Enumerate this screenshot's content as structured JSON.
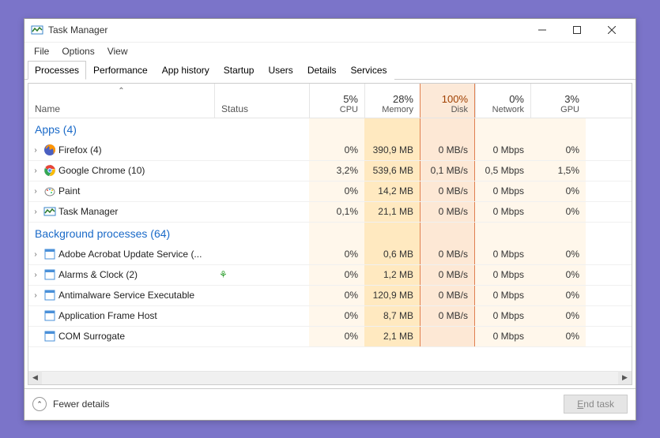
{
  "window": {
    "title": "Task Manager"
  },
  "menu": {
    "file": "File",
    "options": "Options",
    "view": "View"
  },
  "tabs": [
    "Processes",
    "Performance",
    "App history",
    "Startup",
    "Users",
    "Details",
    "Services"
  ],
  "active_tab": 0,
  "columns": {
    "name": "Name",
    "status": "Status",
    "cpu": {
      "pct": "5%",
      "label": "CPU"
    },
    "memory": {
      "pct": "28%",
      "label": "Memory"
    },
    "disk": {
      "pct": "100%",
      "label": "Disk"
    },
    "network": {
      "pct": "0%",
      "label": "Network"
    },
    "gpu": {
      "pct": "3%",
      "label": "GPU"
    }
  },
  "groups": [
    {
      "title": "Apps (4)",
      "rows": [
        {
          "expandable": true,
          "icon": "firefox",
          "name": "Firefox (4)",
          "status": "",
          "cpu": "0%",
          "mem": "390,9 MB",
          "disk": "0 MB/s",
          "net": "0 Mbps",
          "gpu": "0%"
        },
        {
          "expandable": true,
          "icon": "chrome",
          "name": "Google Chrome (10)",
          "status": "",
          "cpu": "3,2%",
          "mem": "539,6 MB",
          "disk": "0,1 MB/s",
          "net": "0,5 Mbps",
          "gpu": "1,5%"
        },
        {
          "expandable": true,
          "icon": "paint",
          "name": "Paint",
          "status": "",
          "cpu": "0%",
          "mem": "14,2 MB",
          "disk": "0 MB/s",
          "net": "0 Mbps",
          "gpu": "0%"
        },
        {
          "expandable": true,
          "icon": "taskmgr",
          "name": "Task Manager",
          "status": "",
          "cpu": "0,1%",
          "mem": "21,1 MB",
          "disk": "0 MB/s",
          "net": "0 Mbps",
          "gpu": "0%"
        }
      ]
    },
    {
      "title": "Background processes (64)",
      "rows": [
        {
          "expandable": true,
          "icon": "app",
          "name": "Adobe Acrobat Update Service (...",
          "status": "",
          "cpu": "0%",
          "mem": "0,6 MB",
          "disk": "0 MB/s",
          "net": "0 Mbps",
          "gpu": "0%"
        },
        {
          "expandable": true,
          "icon": "app",
          "name": "Alarms & Clock (2)",
          "status": "leaf",
          "cpu": "0%",
          "mem": "1,2 MB",
          "disk": "0 MB/s",
          "net": "0 Mbps",
          "gpu": "0%"
        },
        {
          "expandable": true,
          "icon": "app",
          "name": "Antimalware Service Executable",
          "status": "",
          "cpu": "0%",
          "mem": "120,9 MB",
          "disk": "0 MB/s",
          "net": "0 Mbps",
          "gpu": "0%"
        },
        {
          "expandable": false,
          "icon": "app",
          "name": "Application Frame Host",
          "status": "",
          "cpu": "0%",
          "mem": "8,7 MB",
          "disk": "0 MB/s",
          "net": "0 Mbps",
          "gpu": "0%"
        },
        {
          "expandable": false,
          "icon": "app",
          "name": "COM Surrogate",
          "status": "",
          "cpu": "0%",
          "mem": "2,1 MB",
          "disk": "",
          "net": "0 Mbps",
          "gpu": "0%"
        }
      ]
    }
  ],
  "footer": {
    "fewer": "Fewer details",
    "endtask_pre": "E",
    "endtask_post": "nd task"
  },
  "colors": {
    "accent": "#1a6ac8",
    "disk_highlight_border": "#e08050",
    "disk_highlight_bg": "#fce9d8",
    "heat_low": "#fff7eb",
    "heat_mid": "#ffe9c0"
  }
}
